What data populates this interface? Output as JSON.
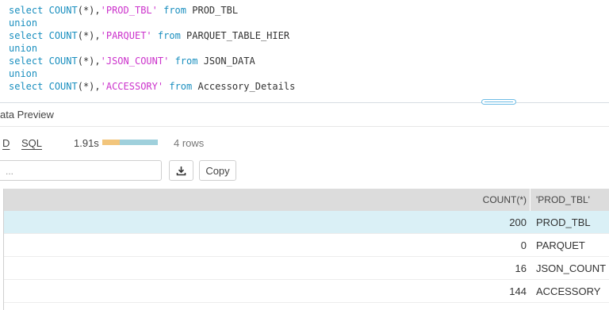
{
  "editor": {
    "lines": [
      {
        "kw1": "select",
        "fn": "COUNT",
        "args": "(*),",
        "str": "'PROD_TBL'",
        "kw2": "from",
        "table": "PROD_TBL"
      },
      {
        "union": "union"
      },
      {
        "kw1": "select",
        "fn": "COUNT",
        "args": "(*),",
        "str": "'PARQUET'",
        "kw2": "from",
        "table": "PARQUET_TABLE_HIER"
      },
      {
        "union": "union"
      },
      {
        "kw1": "select",
        "fn": "COUNT",
        "args": "(*),",
        "str": "'JSON_COUNT'",
        "kw2": "from",
        "table": "JSON_DATA"
      },
      {
        "union": "union"
      },
      {
        "kw1": "select",
        "fn": "COUNT",
        "args": "(*),",
        "str": "'ACCESSORY'",
        "kw2": "from",
        "table": "Accessory_Details"
      }
    ]
  },
  "preview": {
    "title": "ata Preview",
    "tabs": [
      "D",
      "SQL"
    ],
    "exec_time": "1.91s",
    "row_count": "4 rows",
    "search_placeholder": "...",
    "copy_label": "Copy",
    "download_icon": "download-icon"
  },
  "table": {
    "headers": [
      "COUNT(*)",
      "'PROD_TBL'"
    ],
    "rows": [
      {
        "count": "200",
        "label": "PROD_TBL"
      },
      {
        "count": "0",
        "label": "PARQUET"
      },
      {
        "count": "16",
        "label": "JSON_COUNT"
      },
      {
        "count": "144",
        "label": "ACCESSORY"
      }
    ]
  },
  "colors": {
    "keyword": "#1a8fbf",
    "string": "#cc33cc",
    "selected_row": "#daf0f6",
    "header_bg": "#dcdcdc",
    "progress_a": "#f2c57c",
    "progress_b": "#9fd0dc"
  }
}
